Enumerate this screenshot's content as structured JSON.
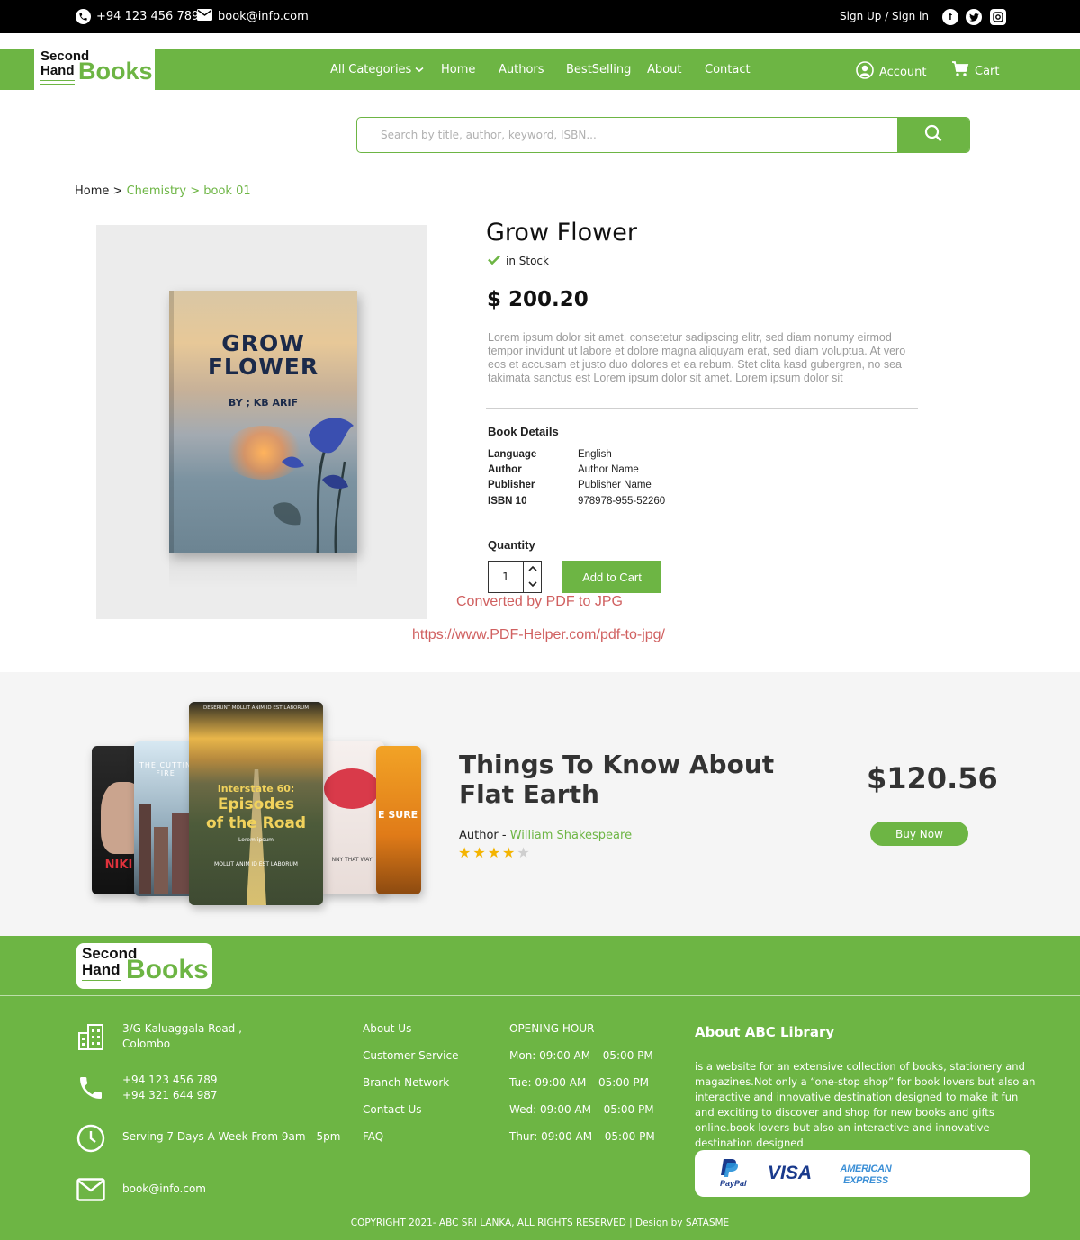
{
  "topbar": {
    "phone": "+94 123 456 789",
    "email": "book@info.com",
    "signup_label": "Sign Up / Sign in",
    "social": [
      "facebook-icon",
      "twitter-icon",
      "instagram-icon"
    ]
  },
  "brand": {
    "line1": "Second",
    "line2": "Hand",
    "line3": "Books",
    "accent_color": "#6db544"
  },
  "nav": {
    "categories": "All Categories",
    "home": "Home",
    "authors": "Authors",
    "bestselling": "BestSelling",
    "about": "About",
    "contact": "Contact",
    "account": "Account",
    "cart": "Cart"
  },
  "search": {
    "placeholder": "Search by title, author, keyword, ISBN..."
  },
  "breadcrumb": {
    "home": "Home",
    "sep": ">",
    "category": "Chemistry",
    "current": "> book 01"
  },
  "product": {
    "cover_title_line1": "GROW",
    "cover_title_line2": "FLOWER",
    "cover_author": "BY ; KB  ARIF",
    "title": "Grow Flower",
    "stock": "in Stock",
    "price": "$ 200.20",
    "description": "Lorem ipsum dolor sit amet, consetetur sadipscing elitr, sed diam nonumy eirmod tempor invidunt ut labore et dolore magna aliquyam erat, sed diam voluptua. At vero eos et accusam et justo duo dolores et ea rebum. Stet clita kasd gubergren, no sea takimata sanctus est Lorem ipsum dolor sit amet. Lorem ipsum dolor sit",
    "details_title": "Book Details",
    "details": [
      {
        "key": "Language",
        "value": "English"
      },
      {
        "key": "Author",
        "value": "Author Name"
      },
      {
        "key": "Publisher",
        "value": "Publisher Name"
      },
      {
        "key": "ISBN 10",
        "value": "978978-955-52260"
      }
    ],
    "quantity_label": "Quantity",
    "quantity": "1",
    "add_to_cart": "Add to Cart"
  },
  "watermark": {
    "line1": "Converted by PDF to JPG",
    "line2": "https://www.PDF-Helper.com/pdf-to-jpg/"
  },
  "featured": {
    "cover_top": "DESERUNT MOLLIT ANIM ID EST LABORUM",
    "cover_sub": "Interstate 60:",
    "cover_main1": "Episodes",
    "cover_main2": "of the Road",
    "cover_small": "Lorem ipsum",
    "cover_bottom": "MOLLIT ANIM ID EST LABORUM",
    "left_cover_text": "THE CUTTIN FIRE",
    "left_cover_word": "NIKI",
    "right_cover_word": "E SURE",
    "right_cover_small": "NNY THAT WAY",
    "title": "Things To Know About Flat Earth",
    "author_label": "Author  -",
    "author_name": "William Shakespeare",
    "rating": 4,
    "rating_max": 5,
    "price": "$120.56",
    "buy_label": "Buy Now"
  },
  "footer": {
    "address_line1": "3/G Kaluaggala Road ,",
    "address_line2": "Colombo",
    "phone1": "+94 123 456 789",
    "phone2": "+94 321 644 987",
    "hours_note": "Serving 7 Days A Week From 9am - 5pm",
    "email": "book@info.com",
    "links": [
      "About Us",
      "Customer Service",
      "Branch Network",
      "Contact Us",
      "FAQ"
    ],
    "opening_title": "OPENING HOUR",
    "opening": [
      "Mon: 09:00 AM – 05:00 PM",
      "Tue: 09:00 AM – 05:00 PM",
      "Wed: 09:00 AM – 05:00 PM",
      "Thur: 09:00 AM – 05:00 PM"
    ],
    "about_title": "About ABC Library",
    "about_text": "is a website for an extensive collection of books, stationery and magazines.Not only a “one-stop shop” for book lovers but also an interactive and innovative destination designed to make it fun and exciting to discover and shop for new books and gifts online.book lovers but also an interactive and innovative destination designed",
    "payments": [
      "PayPal",
      "VISA",
      "AMERICAN",
      "EXPRESS"
    ],
    "copyright": "COPYRIGHT 2021- ABC SRI LANKA, ALL RIGHTS RESERVED  |  Design by SATASME"
  }
}
